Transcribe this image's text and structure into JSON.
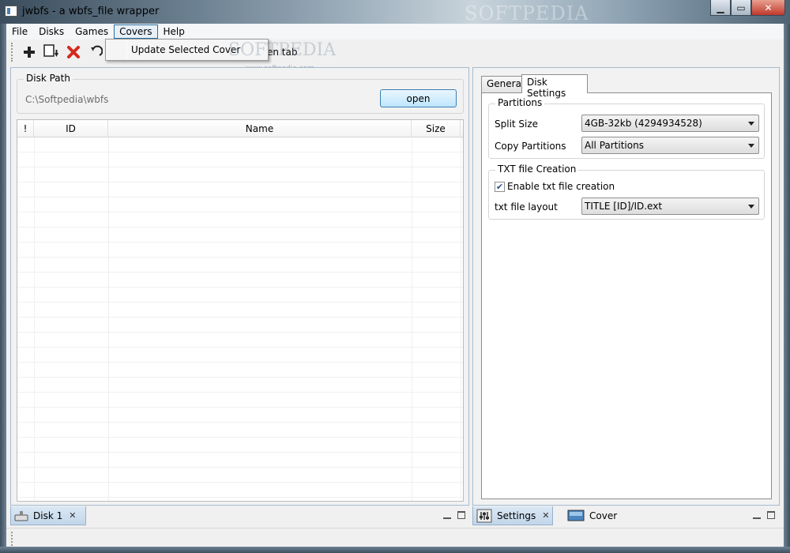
{
  "window": {
    "title": "jwbfs - a wbfs_file wrapper",
    "watermark": "SOFTPEDIA"
  },
  "menu": {
    "items": [
      "File",
      "Disks",
      "Games",
      "Covers",
      "Help"
    ],
    "active": "Covers",
    "dropdown": {
      "item": "Update Selected Cover",
      "watermark": "SOFTPEDIA"
    }
  },
  "toolbar": {
    "icons": [
      "add-icon",
      "export-icon",
      "delete-icon",
      "undo-icon"
    ],
    "partial_label": "en tab",
    "site_url": "www.softpedia.com"
  },
  "left": {
    "group_label": "Disk Path",
    "path": "C:\\Softpedia\\wbfs",
    "open_label": "open",
    "columns": [
      "!",
      "ID",
      "Name",
      "Size"
    ],
    "tab_label": "Disk 1"
  },
  "right": {
    "tabs": [
      "General",
      "Disk Settings"
    ],
    "active_tab": "Disk Settings",
    "partitions": {
      "label": "Partitions",
      "split_size_label": "Split Size",
      "split_size_value": "4GB-32kb (4294934528)",
      "copy_partitions_label": "Copy Partitions",
      "copy_partitions_value": "All Partitions"
    },
    "txt": {
      "label": "TXT file Creation",
      "enable_label": "Enable txt file creation",
      "enable_checked": true,
      "layout_label": "txt file layout",
      "layout_value": "TITLE [ID]/ID.ext"
    },
    "bottom_tabs": [
      "Settings",
      "Cover"
    ]
  },
  "colors": {
    "accent": "#3c7fb1",
    "panel_border": "#a5bccf",
    "delete_red": "#d42a1e"
  }
}
